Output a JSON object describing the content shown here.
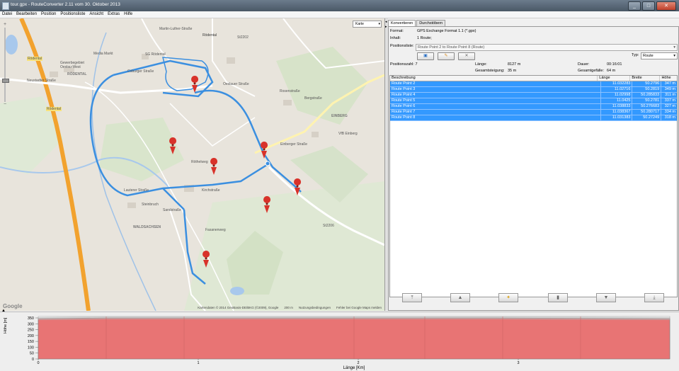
{
  "window": {
    "title": "tour.gpx - RouteConverter 2.11 vom 30. Oktober 2013",
    "buttons": [
      "_",
      "□",
      "✕"
    ]
  },
  "menu": [
    "Datei",
    "Bearbeiten",
    "Position",
    "Positionsliste",
    "Ansicht",
    "Extras",
    "Hilfe"
  ],
  "map": {
    "type_label": "Karte",
    "labels": [
      "Rödental",
      "Media Markt",
      "Gewerbegebiet Oeslau-West",
      "RÖDENTAL",
      "SG Rödental",
      "Martin-Luther-Straße",
      "St2202",
      "Rödental",
      "Neustadter Straße",
      "Coburger Straße",
      "Rödental",
      "EINBERG",
      "Einberger Straße",
      "VfB Einberg",
      "Rosenstraße",
      "Bergstraße",
      "St2206",
      "WALDSACHSEN",
      "Steinbruch",
      "Kirchstraße",
      "Lauterer Straße",
      "Röthelweg",
      "Sandstraße",
      "Oeslauer Straße",
      "Fasanenweg"
    ],
    "footer": {
      "copyright": "Kartendaten © 2014 GeoBasis-DE/BKG (©2009), Google",
      "scale": "200 m",
      "terms": "Nutzungsbedingungen",
      "report": "Fehler bei Google Maps melden"
    },
    "logo": "Google",
    "marker_icon": "map-pin-icon"
  },
  "tabs": [
    "Konvertieren",
    "Durchstöbern"
  ],
  "info": {
    "format_label": "Format:",
    "format_value": "GPS Exchange Format 1.1 (*.gpx)",
    "content_label": "Inhalt:",
    "content_value": "1 Route;",
    "poslist_label": "Positionsliste:",
    "poslist_value": "Route Point 2 to Route Point 8 (Route)",
    "type_label": "Typ:",
    "type_value": "Route"
  },
  "stats": {
    "count_label": "Positionszahl:",
    "count_value": "7",
    "length_label": "Länge:",
    "length_value": "8127 m",
    "duration_label": "Dauer:",
    "duration_value": "00:16:01",
    "ascent_label": "Gesamtsteigung:",
    "ascent_value": "35 m",
    "descent_label": "Gesamtgefälle:",
    "descent_value": "64 m"
  },
  "table": {
    "headers": [
      "Beschreibung",
      "Länge",
      "Breite",
      "Höhe"
    ],
    "rows": [
      [
        "Route Point 2",
        "11.032283",
        "50.2796",
        "347 m"
      ],
      [
        "Route Point 3",
        "11.02716",
        "50.2819",
        "349 m"
      ],
      [
        "Route Point 4",
        "11.02998",
        "50.285833",
        "311 m"
      ],
      [
        "Route Point 5",
        "11.0425",
        "50.2781",
        "337 m"
      ],
      [
        "Route Point 6",
        "11.038833",
        "50.276683",
        "327 m"
      ],
      [
        "Route Point 7",
        "11.038367",
        "50.280717",
        "334 m"
      ],
      [
        "Route Point 8",
        "11.031383",
        "50.27249",
        "318 m"
      ]
    ]
  },
  "profile": {
    "ylabel": "Höhe [m]",
    "xlabel": "Länge [Km]",
    "yticks": [
      "350",
      "300",
      "250",
      "200",
      "150",
      "100",
      "50",
      "0"
    ],
    "xticks": [
      "0",
      "1",
      "2",
      "3"
    ],
    "fill_color": "#e87474"
  }
}
